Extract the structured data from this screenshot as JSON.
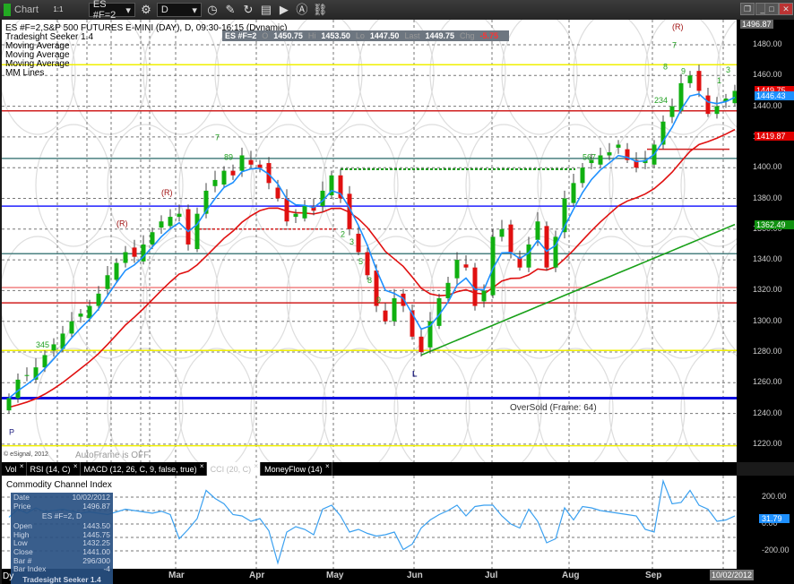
{
  "window": {
    "title": "Chart",
    "badge": "1:1",
    "symbol": "ES #F=2",
    "interval": "D",
    "controls": [
      "restore",
      "minimize",
      "maximize",
      "close"
    ]
  },
  "legend": {
    "title": "ES #F=2,S&P 500 FUTURES E-MINI (DAY), D, 09:30-16:15 (Dynamic)",
    "studies": [
      "Tradesight Seeker 1.4",
      "Moving Average",
      "Moving Average",
      "Moving Average",
      "MM Lines"
    ]
  },
  "quote": {
    "symbol": "ES #F=2",
    "o_label": "O",
    "open": "1450.75",
    "hi_label": "Hi",
    "high": "1453.50",
    "lo_label": "Lo",
    "low": "1447.50",
    "last_label": "Last",
    "last": "1449.75",
    "chg_label": "Chg",
    "chg": "-5.75"
  },
  "footer": {
    "copyright": "© eSignal, 2012",
    "autoframe": "AutoFrame is OFF",
    "oversold": "OverSold (Frame: 64)"
  },
  "price_axis": {
    "top": "1496.87",
    "ticks": [
      "1480.00",
      "1460.00",
      "1440.00",
      "1420.00",
      "1400.00",
      "1380.00",
      "1360.00",
      "1340.00",
      "1320.00",
      "1300.00",
      "1280.00",
      "1260.00",
      "1240.00",
      "1220.00"
    ],
    "tags": [
      {
        "text": "1449.75",
        "color": "#e00000",
        "price": 1449.75
      },
      {
        "text": "1446.43",
        "color": "#1e90ff",
        "price": 1446.43
      },
      {
        "text": "1419.87",
        "color": "#e00000",
        "price": 1419.87
      },
      {
        "text": "1362.49",
        "color": "#109010",
        "price": 1362.49
      }
    ]
  },
  "tabs": [
    {
      "label": "Vol"
    },
    {
      "label": "RSI (14, C)"
    },
    {
      "label": "MACD (12, 26, C, 9, false, true)"
    },
    {
      "label": "CCI (20, C)",
      "active": true
    },
    {
      "label": "MoneyFlow (14)"
    }
  ],
  "cci_pane": {
    "title": "Commodity Channel Index",
    "ticks": [
      "200.00",
      "0.00",
      "-200.00"
    ],
    "last": "31.79"
  },
  "time_axis": {
    "months": [
      "Mar",
      "Apr",
      "May",
      "Jun",
      "Jul",
      "Aug",
      "Sep"
    ],
    "cursor_date": "10/02/2012"
  },
  "infobox": {
    "date_label": "Date",
    "date": "10/02/2012",
    "price_label": "Price",
    "price": "1496.87",
    "symbol": "ES #F=2, D",
    "rows": [
      [
        "Open",
        "1443.50"
      ],
      [
        "High",
        "1445.75"
      ],
      [
        "Low",
        "1432.25"
      ],
      [
        "Close",
        "1441.00"
      ],
      [
        "Bar #",
        "296/300"
      ],
      [
        "Bar Index",
        "-4"
      ]
    ],
    "footer": "Tradesight Seeker 1.4",
    "corner": "Dy"
  },
  "markers": [
    {
      "text": "(R)",
      "i": 12,
      "price": 1362
    },
    {
      "text": "(R)",
      "i": 17,
      "price": 1382
    },
    {
      "text": "(R)",
      "i": 74,
      "price": 1490
    },
    {
      "text": "L",
      "i": 45,
      "price": 1264
    },
    {
      "text": "P",
      "i": 0,
      "price": 1226
    },
    {
      "text": "7",
      "i": 23,
      "price": 1418
    },
    {
      "text": "7",
      "i": 74,
      "price": 1478
    },
    {
      "text": "8",
      "i": 73,
      "price": 1464
    },
    {
      "text": "9",
      "i": 75,
      "price": 1461
    },
    {
      "text": "1",
      "i": 79,
      "price": 1455
    },
    {
      "text": "3",
      "i": 80,
      "price": 1462
    },
    {
      "text": "2",
      "i": 37,
      "price": 1355
    },
    {
      "text": "3",
      "i": 38,
      "price": 1350
    },
    {
      "text": "5",
      "i": 39,
      "price": 1337
    },
    {
      "text": "8",
      "i": 40,
      "price": 1325
    },
    {
      "text": "9",
      "i": 41,
      "price": 1312
    },
    {
      "text": "567",
      "i": 64,
      "price": 1405
    },
    {
      "text": "234",
      "i": 72,
      "price": 1442
    },
    {
      "text": "345",
      "i": 3,
      "price": 1283
    },
    {
      "text": "89",
      "i": 24,
      "price": 1405
    }
  ],
  "mm_lines": [
    {
      "price": 1467,
      "color": "#f0f000"
    },
    {
      "price": 1437,
      "color": "#d02020"
    },
    {
      "price": 1406,
      "color": "#4a8080"
    },
    {
      "price": 1375,
      "color": "#2020ff"
    },
    {
      "price": 1344,
      "color": "#4a8080"
    },
    {
      "price": 1322,
      "color": "#f08080"
    },
    {
      "price": 1312,
      "color": "#d02020"
    },
    {
      "price": 1281,
      "color": "#f0f000"
    },
    {
      "price": 1250,
      "color": "#1010e0",
      "thick": true
    },
    {
      "price": 1219,
      "color": "#f0f000"
    }
  ],
  "chart_data": {
    "type": "candlestick",
    "symbol": "ES #F=2",
    "ylim": [
      1215,
      1497
    ],
    "closes": [
      1250,
      1262,
      1265,
      1270,
      1278,
      1285,
      1292,
      1300,
      1305,
      1310,
      1318,
      1330,
      1338,
      1345,
      1342,
      1350,
      1358,
      1365,
      1368,
      1370,
      1350,
      1370,
      1385,
      1392,
      1398,
      1395,
      1408,
      1402,
      1400,
      1390,
      1380,
      1365,
      1370,
      1375,
      1372,
      1385,
      1395,
      1380,
      1360,
      1345,
      1330,
      1310,
      1300,
      1315,
      1310,
      1290,
      1280,
      1300,
      1315,
      1325,
      1340,
      1335,
      1310,
      1320,
      1355,
      1360,
      1345,
      1335,
      1350,
      1365,
      1335,
      1355,
      1380,
      1390,
      1400,
      1405,
      1408,
      1410,
      1415,
      1405,
      1400,
      1405,
      1415,
      1430,
      1440,
      1455,
      1460,
      1450,
      1435,
      1440,
      1445,
      1450
    ],
    "cci": [
      50,
      110,
      80,
      120,
      90,
      100,
      110,
      95,
      80,
      90,
      80,
      70,
      90,
      110,
      100,
      90,
      80,
      95,
      70,
      -110,
      -40,
      40,
      250,
      190,
      150,
      70,
      60,
      20,
      40,
      -50,
      -290,
      -60,
      -20,
      -40,
      -80,
      110,
      140,
      60,
      -60,
      -40,
      -70,
      -90,
      -80,
      -60,
      -190,
      -150,
      -30,
      30,
      70,
      100,
      140,
      60,
      130,
      140,
      140,
      60,
      0,
      -30,
      110,
      20,
      -140,
      -110,
      120,
      30,
      130,
      120,
      100,
      90,
      80,
      70,
      60,
      -40,
      -60,
      320,
      150,
      160,
      250,
      140,
      110,
      20,
      30,
      60
    ]
  }
}
